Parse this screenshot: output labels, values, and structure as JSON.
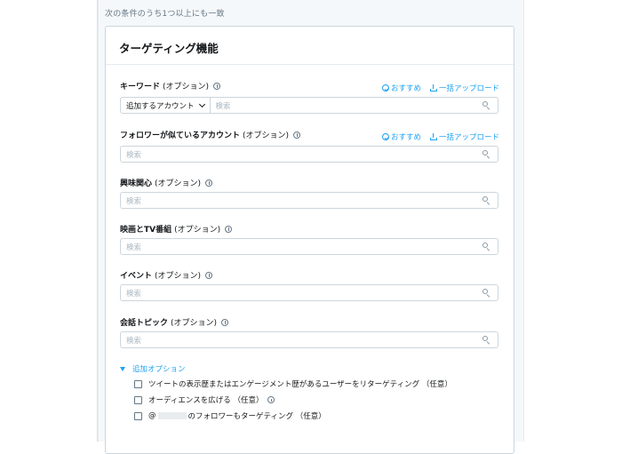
{
  "condition_text": "次の条件のうち1つ以上にも一致",
  "card_title": "ターゲティング機能",
  "recommend_label": "おすすめ",
  "bulk_upload_label": "一括アップロード",
  "fields": {
    "keyword": {
      "label": "キーワード",
      "optional": "(オプション)",
      "account_select": "追加するアカウント",
      "placeholder": "検索"
    },
    "follower_lookalike": {
      "label": "フォロワーが似ているアカウント",
      "optional": "(オプション)",
      "placeholder": "検索"
    },
    "interests": {
      "label": "興味関心",
      "optional": "(オプション)",
      "placeholder": "検索"
    },
    "movies_tv": {
      "label": "映画とTV番組",
      "optional": "(オプション)",
      "placeholder": "検索"
    },
    "events": {
      "label": "イベント",
      "optional": "(オプション)",
      "placeholder": "検索"
    },
    "conversation_topics": {
      "label": "会話トピック",
      "optional": "(オプション)",
      "placeholder": "検索"
    }
  },
  "additional_options": {
    "label": "追加オプション",
    "items": [
      "ツイートの表示歴またはエンゲージメント歴があるユーザーをリターゲティング （任意）",
      "オーディエンスを広げる （任意）",
      "のフォロワーもターゲティング （任意）"
    ],
    "handle_prefix": "@"
  }
}
